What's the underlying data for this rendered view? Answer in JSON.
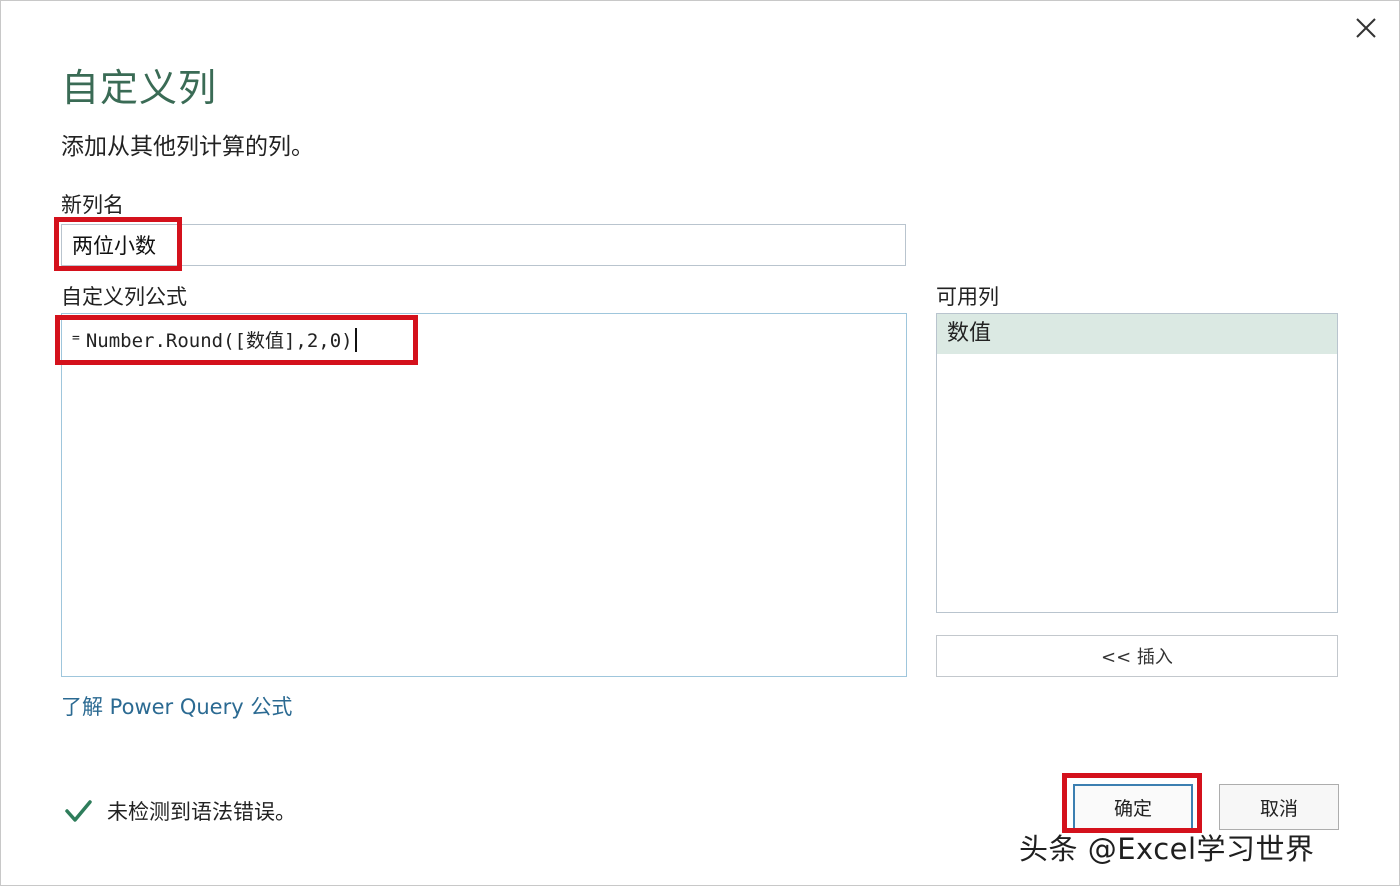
{
  "dialog": {
    "title": "自定义列",
    "description": "添加从其他列计算的列。",
    "close_icon": "close-icon"
  },
  "new_column": {
    "label": "新列名",
    "value": "两位小数"
  },
  "formula": {
    "label": "自定义列公式",
    "eq": "=",
    "value": "Number.Round([数值],2,0)"
  },
  "available_columns": {
    "label": "可用列",
    "items": [
      "数值"
    ],
    "insert_label": "<< 插入"
  },
  "learn_link": "了解 Power Query 公式",
  "status": {
    "icon": "checkmark-icon",
    "text": "未检测到语法错误。",
    "color": "#2e7d5b"
  },
  "buttons": {
    "ok": "确定",
    "cancel": "取消"
  },
  "highlight_color": "#d4111c",
  "watermark": "头条 @Excel学习世界"
}
